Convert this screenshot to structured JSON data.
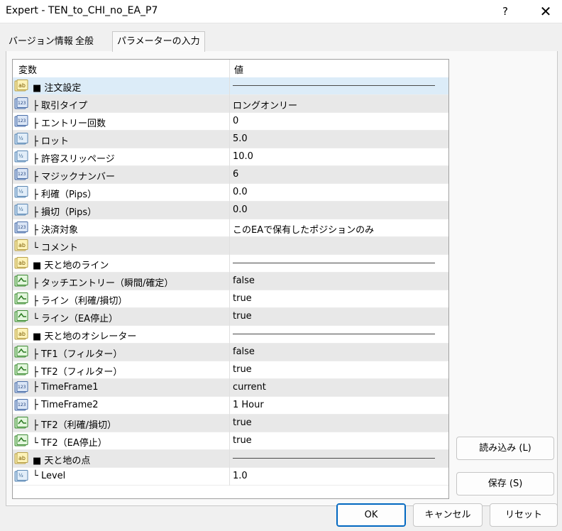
{
  "window": {
    "title": "Expert - TEN_to_CHI_no_EA_P7",
    "help": "?",
    "close": "✕"
  },
  "tabs": [
    {
      "label": "バージョン情報"
    },
    {
      "label": "全般"
    },
    {
      "label": "パラメーターの入力"
    }
  ],
  "grid": {
    "col_name": "変数",
    "col_value": "値",
    "rows": [
      {
        "icon": "ab",
        "name": "■ 注文設定",
        "value": "",
        "line": true
      },
      {
        "icon": "123",
        "name": "├ 取引タイプ",
        "value": "ロングオンリー"
      },
      {
        "icon": "123",
        "name": "├ エントリー回数",
        "value": "0"
      },
      {
        "icon": "half",
        "name": "├ ロット",
        "value": "5.0"
      },
      {
        "icon": "half",
        "name": "├ 許容スリッページ",
        "value": "10.0"
      },
      {
        "icon": "123",
        "name": "├ マジックナンバー",
        "value": "6"
      },
      {
        "icon": "half",
        "name": "├ 利確（Pips）",
        "value": "0.0"
      },
      {
        "icon": "half",
        "name": "├ 損切（Pips）",
        "value": "0.0"
      },
      {
        "icon": "123",
        "name": "├ 決済対象",
        "value": "このEAで保有したポジションのみ"
      },
      {
        "icon": "ab",
        "name": "└ コメント",
        "value": ""
      },
      {
        "icon": "ab",
        "name": "■ 天と地のライン",
        "value": "",
        "line": true
      },
      {
        "icon": "bool",
        "name": "├ タッチエントリー（瞬間/確定）",
        "value": "false"
      },
      {
        "icon": "bool",
        "name": "├ ライン（利確/損切）",
        "value": "true"
      },
      {
        "icon": "bool",
        "name": "└ ライン（EA停止）",
        "value": "true"
      },
      {
        "icon": "ab",
        "name": "■ 天と地のオシレーター",
        "value": "",
        "line": true
      },
      {
        "icon": "bool",
        "name": "├ TF1（フィルター）",
        "value": "false"
      },
      {
        "icon": "bool",
        "name": "├ TF2（フィルター）",
        "value": "true"
      },
      {
        "icon": "123",
        "name": "├ TimeFrame1",
        "value": "current"
      },
      {
        "icon": "123",
        "name": "├ TimeFrame2",
        "value": "1 Hour"
      },
      {
        "icon": "bool",
        "name": "├ TF2（利確/損切）",
        "value": "true"
      },
      {
        "icon": "bool",
        "name": "└ TF2（EA停止）",
        "value": "true"
      },
      {
        "icon": "ab",
        "name": "■ 天と地の点",
        "value": "",
        "line": true
      },
      {
        "icon": "half",
        "name": "└ Level",
        "value": "1.0"
      }
    ]
  },
  "buttons": {
    "load": "読み込み (L)",
    "save": "保存 (S)",
    "ok": "OK",
    "cancel": "キャンセル",
    "reset": "リセット"
  }
}
